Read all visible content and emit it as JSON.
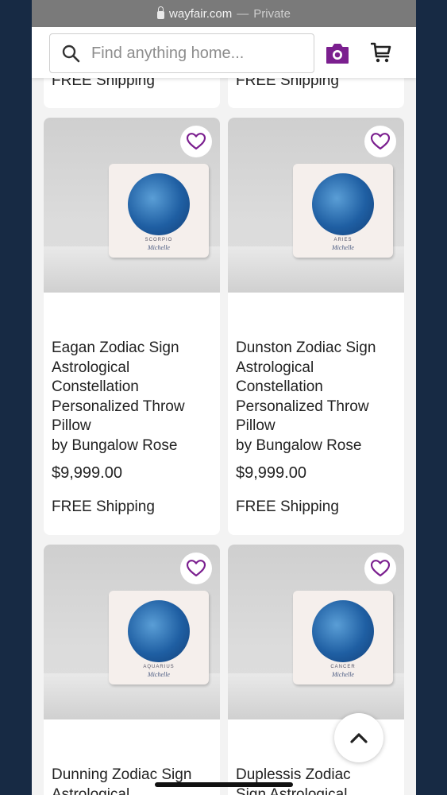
{
  "browser": {
    "domain": "wayfair.com",
    "separator": "—",
    "privacy": "Private"
  },
  "search": {
    "placeholder": "Find anything home..."
  },
  "colors": {
    "brand_purple": "#7b1f8f",
    "frame": "#172a44"
  },
  "icons": [
    "search-icon",
    "camera-icon",
    "cart-icon",
    "heart-icon",
    "chevron-up-icon",
    "lock-icon"
  ],
  "top_row": [
    {
      "shipping": "FREE Shipping"
    },
    {
      "shipping": "FREE Shipping"
    }
  ],
  "products": [
    {
      "title": "Eagan Zodiac Sign\nAstrological\nConstellation\nPersonalized Throw\nPillow\nby Bungalow Rose",
      "price": "$9,999.00",
      "shipping": "FREE Shipping",
      "image_sign": "SCORPIO",
      "image_name": "Michelle"
    },
    {
      "title": "Dunston Zodiac Sign\nAstrological\nConstellation\nPersonalized Throw\nPillow\nby Bungalow Rose",
      "price": "$9,999.00",
      "shipping": "FREE Shipping",
      "image_sign": "ARIES",
      "image_name": "Michelle"
    },
    {
      "title": "Dunning Zodiac Sign\nAstrological",
      "image_sign": "AQUARIUS",
      "image_name": "Michelle"
    },
    {
      "title": "Duplessis Zodiac\nSign Astrological",
      "image_sign": "CANCER",
      "image_name": "Michelle"
    }
  ]
}
